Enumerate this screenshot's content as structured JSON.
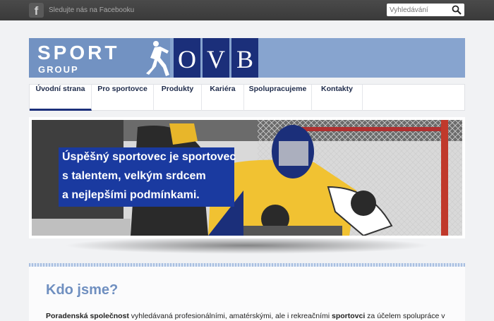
{
  "topbar": {
    "facebook_text": "Sledujte nás na Facebooku",
    "facebook_icon": "f"
  },
  "search": {
    "placeholder": "Vyhledávání"
  },
  "logo": {
    "sport": "SPORT",
    "group": "GROUP",
    "letters": [
      "O",
      "V",
      "B"
    ]
  },
  "nav": {
    "items": [
      "Úvodní strana",
      "Pro sportovce",
      "Produkty",
      "Kariéra",
      "Spolupracujeme",
      "Kontakty"
    ],
    "active": 0
  },
  "hero": {
    "caption": [
      "Úspěšný sportovec je sportovec",
      "s talentem, velkým srdcem",
      "a nejlepšími podmínkami."
    ]
  },
  "content": {
    "heading": "Kdo jsme?",
    "para_bold1": "Poradenská společnost",
    "para_text1": " vyhledávaná profesionálními, amatérskými, ale i rekreačními ",
    "para_bold2": "sportovci",
    "para_text2": " za účelem spolupráce v"
  },
  "colors": {
    "brand_navy": "#1b2f7a",
    "logo_blue": "#87a4cf",
    "caption_blue": "#1a3aa0",
    "heading_blue": "#6f8fc0"
  }
}
